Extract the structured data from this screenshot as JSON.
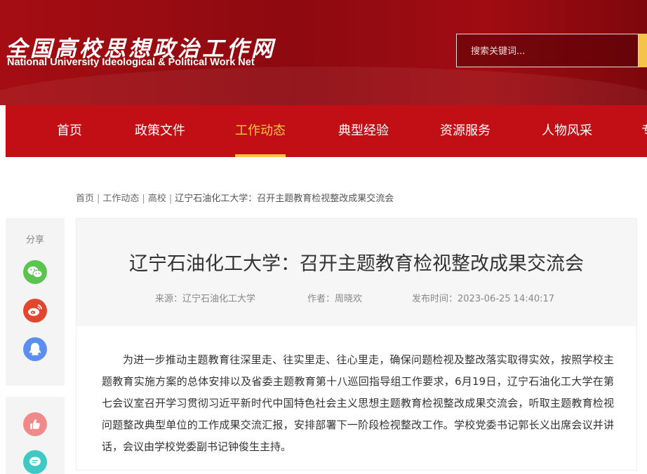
{
  "site": {
    "name_cn": "全国高校思想政治工作网",
    "name_en": "National University Ideological & Political Work Net"
  },
  "search": {
    "placeholder": "搜索关键词..."
  },
  "nav": {
    "items": [
      {
        "label": "首页",
        "active": false
      },
      {
        "label": "政策文件",
        "active": false
      },
      {
        "label": "工作动态",
        "active": true
      },
      {
        "label": "典型经验",
        "active": false
      },
      {
        "label": "资源服务",
        "active": false
      },
      {
        "label": "人物风采",
        "active": false
      },
      {
        "label": "专",
        "active": false
      }
    ]
  },
  "breadcrumb": {
    "items": [
      "首页",
      "工作动态",
      "高校",
      "辽宁石油化工大学：召开主题教育检视整改成果交流会"
    ],
    "separator": "|"
  },
  "share": {
    "label": "分享",
    "icons": [
      "wechat-icon",
      "weibo-icon",
      "qq-icon",
      "like-icon",
      "comment-icon"
    ]
  },
  "article": {
    "title": "辽宁石油化工大学：召开主题教育检视整改成果交流会",
    "source": "来源：辽宁石油化工大学",
    "author": "作者：周晓欢",
    "published": "发布时间：2023-06-25 14:40:17",
    "body": "为进一步推动主题教育往深里走、往实里走、往心里走，确保问题检视及整改落实取得实效，按照学校主题教育实施方案的总体安排以及省委主题教育第十八巡回指导组工作要求，6月19日，辽宁石油化工大学在第七会议室召开学习贯彻习近平新时代中国特色社会主义思想主题教育检视整改成果交流会，听取主题教育检视问题整改典型单位的工作成果交流汇报，安排部署下一阶段检视整改工作。学校党委书记郭长义出席会议并讲话，会议由学校党委副书记钟俊生主持。"
  },
  "colors": {
    "header_red": "#a50d13",
    "nav_red": "#c20f16",
    "accent_gold": "#f7c441",
    "wechat_green": "#5bc44e",
    "weibo_red": "#e2462f",
    "qq_blue": "#5b8ef0",
    "like_pink": "#f08a8a",
    "comment_teal": "#3fc9c4"
  }
}
